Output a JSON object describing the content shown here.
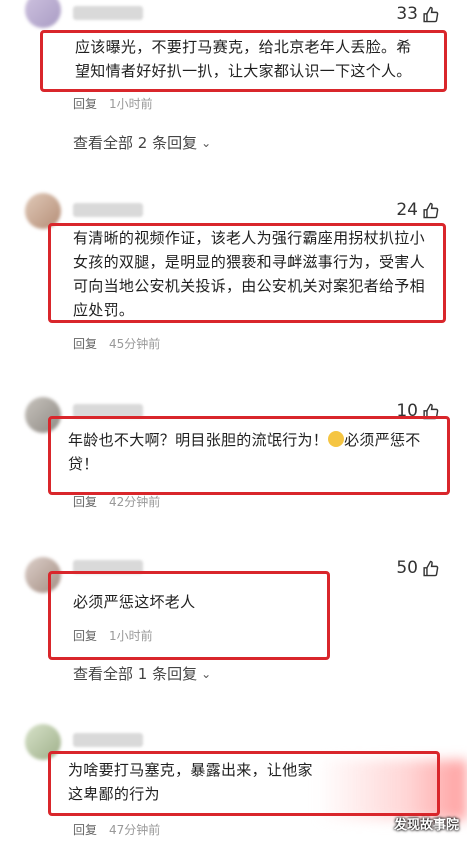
{
  "comments": [
    {
      "likes": "33",
      "text": "应该曝光，不要打马赛克，给北京老年人丢脸。希望知情者好好扒一扒，让大家都认识一下这个人。",
      "reply": "回复",
      "time": "1小时前",
      "view_all": "查看全部 2 条回复"
    },
    {
      "likes": "24",
      "text": "有清晰的视频作证，该老人为强行霸座用拐杖扒拉小女孩的双腿，是明显的猥亵和寻衅滋事行为，受害人可向当地公安机关投诉，由公安机关对案犯者给予相应处罚。",
      "reply": "回复",
      "time": "45分钟前"
    },
    {
      "likes": "10",
      "text_before_emoji": "年龄也不大啊？明目张胆的流氓行为！",
      "text_after_emoji": "必须严惩不贷！",
      "reply": "回复",
      "time": "42分钟前"
    },
    {
      "likes": "50",
      "text": "必须严惩这坏老人",
      "reply": "回复",
      "time": "1小时前",
      "view_all": "查看全部 1 条回复"
    },
    {
      "text": "为啥要打马塞克，暴露出来，让他家这卑鄙的行为",
      "reply": "回复",
      "time": "47分钟前"
    }
  ],
  "watermark": "发现故事院",
  "colors": {
    "highlight_box": "#d9262b"
  },
  "icons": {
    "like": "thumbs-up-icon",
    "expand": "chevron-down-icon",
    "emoji": "smirk-emoji-icon"
  }
}
